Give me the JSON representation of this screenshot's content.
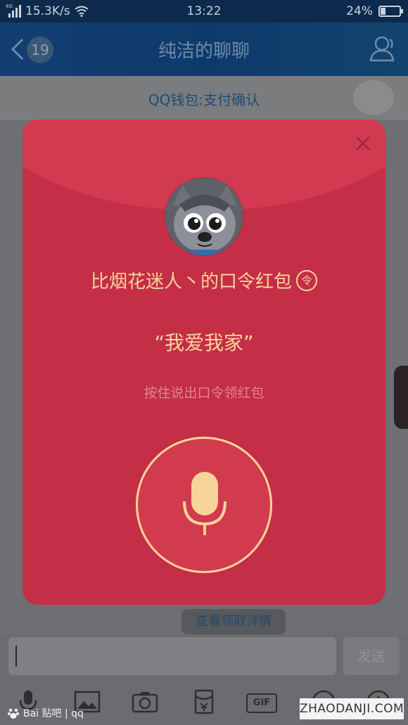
{
  "status_bar": {
    "network_type": "4G",
    "speed": "15.3K/s",
    "time": "13:22",
    "battery": "24%",
    "battery_level": 0.24
  },
  "title_bar": {
    "unread_count": "19",
    "title": "纯洁的聊聊"
  },
  "notice": {
    "text": "QQ钱包:支付确认"
  },
  "red_packet": {
    "sender_title": "比烟花迷人丶的口令红包",
    "token_symbol": "令",
    "password": "“我爱我家”",
    "hint": "按住说出口令领红包"
  },
  "footer": {
    "detail_link": "查看领取详情",
    "send_label": "发送",
    "gif_label": "GIF"
  },
  "watermark": {
    "left_text": "Bai 贴吧 | qq",
    "right_text": "ZHAODANJI.COM"
  },
  "colors": {
    "packet_red": "#c42e47",
    "packet_top": "#d13a51",
    "gold": "#f7d49a",
    "title_bar": "#0e3a6b"
  }
}
